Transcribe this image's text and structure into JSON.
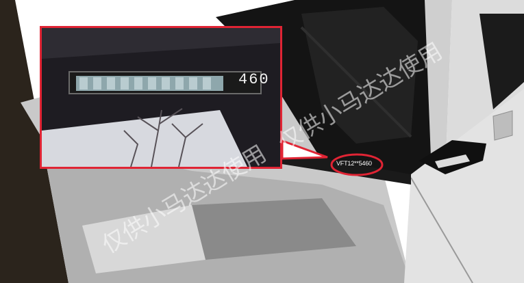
{
  "zoom": {
    "vin_digits": "460"
  },
  "callout": {
    "vin_text": "VFT12**5460"
  },
  "watermarks": [
    "仅供小马达达使用",
    "仅供小马达达使用"
  ],
  "colors": {
    "highlight_red": "#e02434",
    "car_body": "#d6d6d6",
    "glass": "#0c0c0c"
  }
}
